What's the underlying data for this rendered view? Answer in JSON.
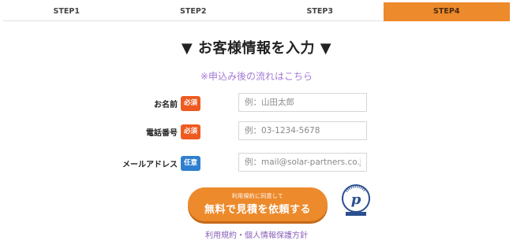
{
  "steps": [
    {
      "label": "STEP1",
      "active": false
    },
    {
      "label": "STEP2",
      "active": false
    },
    {
      "label": "STEP3",
      "active": false
    },
    {
      "label": "STEP4",
      "active": true
    }
  ],
  "heading": "▼ お客様情報を入力 ▼",
  "subnote": "※申込み後の流れはこちら",
  "form": {
    "name": {
      "label": "お名前",
      "badge": "必須",
      "placeholder": "例：山田太郎",
      "value": ""
    },
    "phone": {
      "label": "電話番号",
      "badge": "必須",
      "placeholder": "例：03-1234-5678",
      "value": ""
    },
    "email": {
      "label": "メールアドレス",
      "badge": "任意",
      "placeholder": "例：mail@solar-partners.co.jp",
      "value": ""
    }
  },
  "cta": {
    "small": "利用規約に同意して",
    "main": "無料で見積を依頼する"
  },
  "privacy_mark_icon": "privacy-mark-icon",
  "footer_link": "利用規約・個人情報保護方針",
  "colors": {
    "accent": "#ec8a2c",
    "required": "#ee5a1f",
    "optional": "#2f7fd0",
    "link": "#a57ad6"
  }
}
